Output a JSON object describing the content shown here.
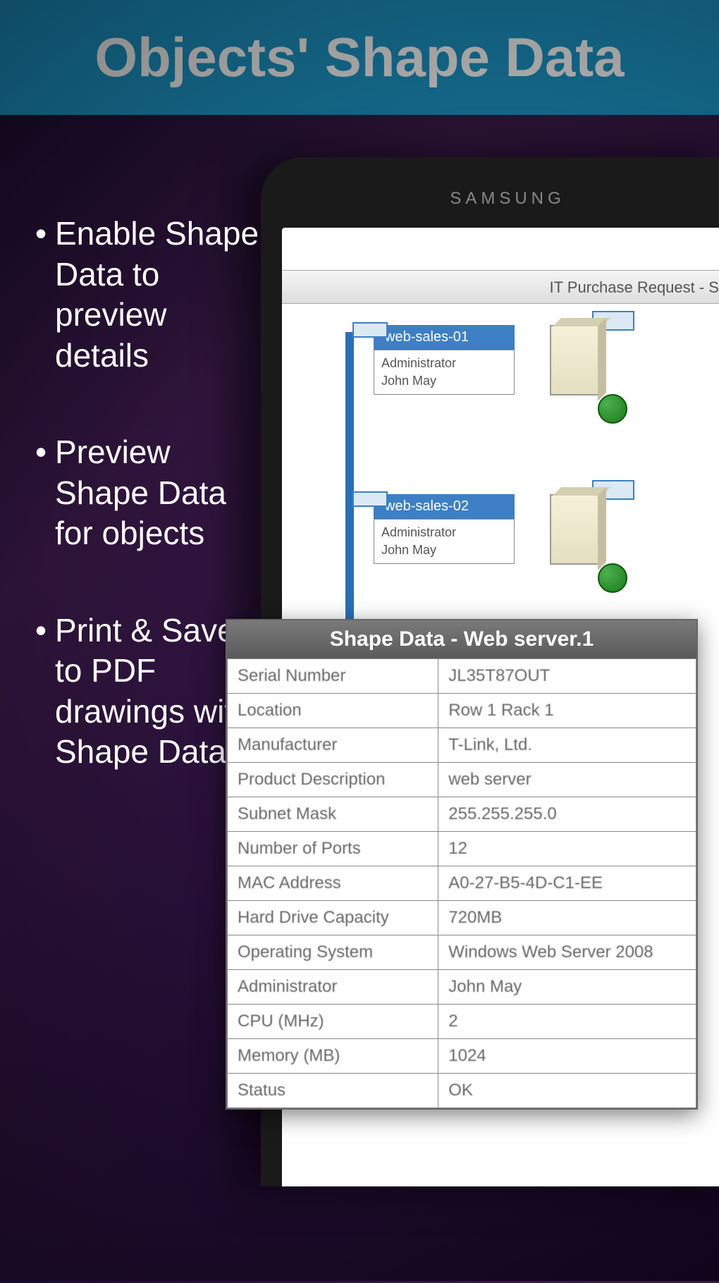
{
  "header": {
    "title": "Objects' Shape Data"
  },
  "bullets": [
    "Enable Shape Data to preview details",
    "Preview Shape Data for objects",
    "Print & Save to PDF drawings with Shape Data!"
  ],
  "phone": {
    "brand": "SAMSUNG",
    "screen_title": "IT Purchase Request - S",
    "shapes": [
      {
        "name": "web-sales-01",
        "admin_label": "Administrator",
        "admin_value": "John May"
      },
      {
        "name": "web-sales-02",
        "admin_label": "Administrator",
        "admin_value": "John May"
      }
    ]
  },
  "popup": {
    "title": "Shape Data - Web server.1",
    "rows": [
      {
        "k": "Serial Number",
        "v": "JL35T87OUT"
      },
      {
        "k": "Location",
        "v": "Row 1 Rack 1"
      },
      {
        "k": "Manufacturer",
        "v": "T-Link, Ltd."
      },
      {
        "k": "Product Description",
        "v": "web server"
      },
      {
        "k": "Subnet Mask",
        "v": "255.255.255.0"
      },
      {
        "k": "Number of Ports",
        "v": "12"
      },
      {
        "k": "MAC Address",
        "v": "A0-27-B5-4D-C1-EE"
      },
      {
        "k": "Hard Drive Capacity",
        "v": "720MB"
      },
      {
        "k": "Operating System",
        "v": "Windows Web Server 2008"
      },
      {
        "k": "Administrator",
        "v": "John May"
      },
      {
        "k": "CPU (MHz)",
        "v": "2"
      },
      {
        "k": "Memory (MB)",
        "v": "1024"
      },
      {
        "k": "Status",
        "v": "OK"
      }
    ]
  }
}
